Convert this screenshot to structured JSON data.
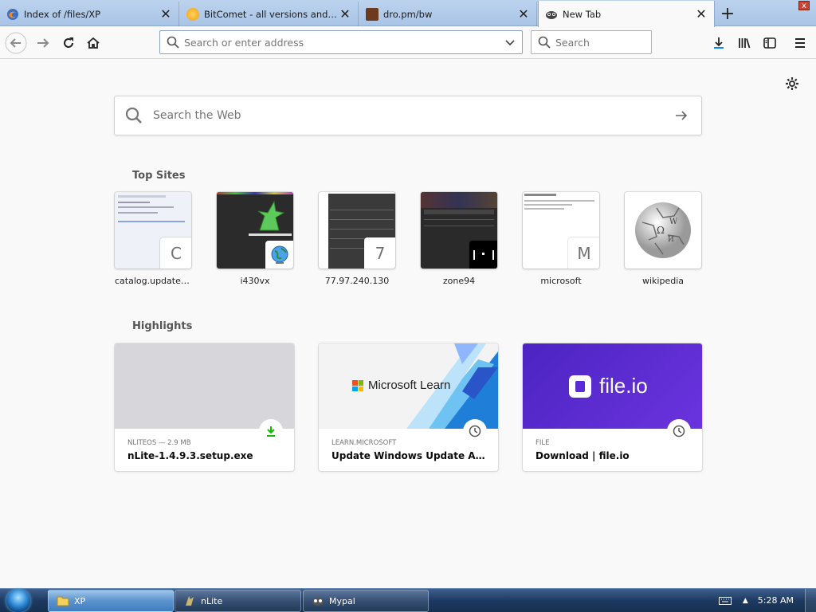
{
  "tabs": [
    {
      "title": "Index of /files/XP",
      "favicon": "firefox-icon"
    },
    {
      "title": "BitComet - all versions and zip",
      "favicon": "bitcomet-icon"
    },
    {
      "title": "dro.pm/bw",
      "favicon": "dro-icon"
    },
    {
      "title": "New Tab",
      "favicon": "mypal-icon",
      "active": true
    }
  ],
  "window": {
    "close_label": "x"
  },
  "navbar": {
    "url_placeholder": "Search or enter address",
    "search_placeholder": "Search"
  },
  "newtab": {
    "web_search_placeholder": "Search the Web",
    "top_sites_title": "Top Sites",
    "highlights_title": "Highlights",
    "top_sites": [
      {
        "label": "catalog.update....",
        "badge": "C"
      },
      {
        "label": "i430vx",
        "badge": "globe-icon"
      },
      {
        "label": "77.97.240.130",
        "badge": "7"
      },
      {
        "label": "zone94",
        "badge": "pong-icon"
      },
      {
        "label": "microsoft",
        "badge": "M"
      },
      {
        "label": "wikipedia",
        "badge": "wikipedia-globe-icon"
      }
    ],
    "highlights": [
      {
        "meta": "NLITEOS — 2.9 MB",
        "name": "nLite-1.4.9.3.setup.exe",
        "type": "download"
      },
      {
        "meta": "LEARN.MICROSOFT",
        "name": "Update Windows Update Agent ...",
        "type": "history",
        "image_text": "Microsoft Learn"
      },
      {
        "meta": "FILE",
        "name": "Download | file.io",
        "type": "history",
        "image_text": "file.io"
      }
    ]
  },
  "taskbar": {
    "buttons": [
      {
        "label": "XP",
        "icon": "folder-icon",
        "active": true
      },
      {
        "label": "nLite",
        "icon": "nlite-icon"
      },
      {
        "label": "Mypal",
        "icon": "mypal-icon"
      }
    ],
    "clock": "5:28 AM"
  },
  "colors": {
    "accent": "#0a84ff",
    "download_green": "#12bc00",
    "fileio_purple": "#5a2bd6"
  }
}
